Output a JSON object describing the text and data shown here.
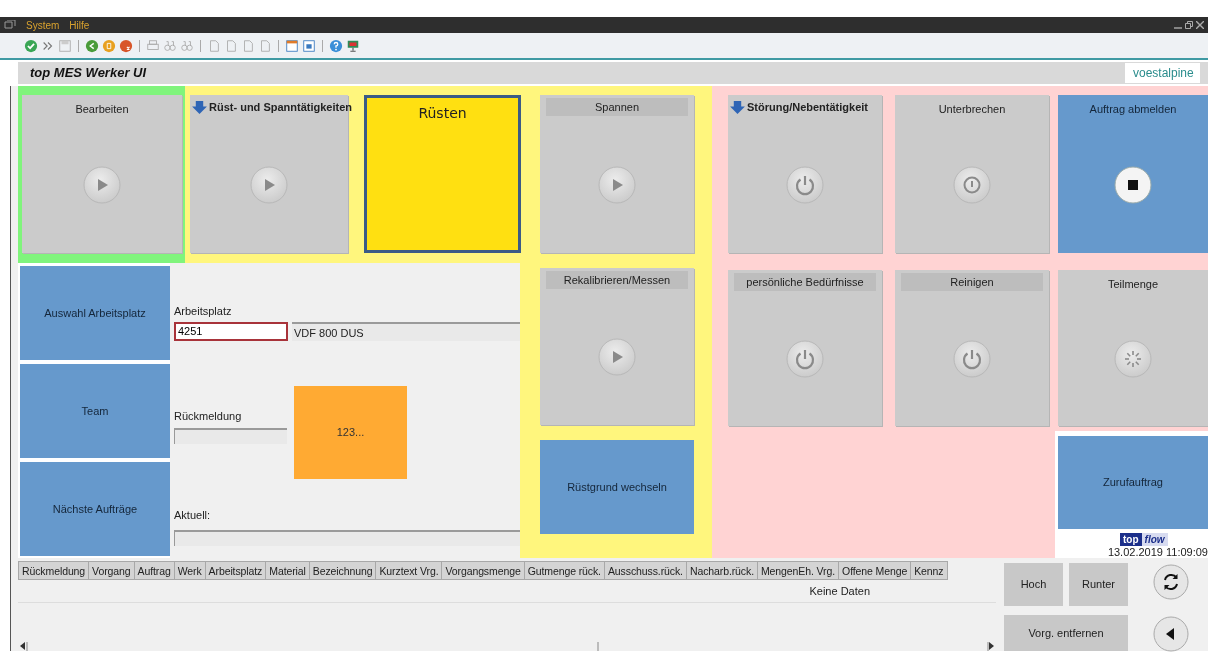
{
  "menu": [
    {
      "label": "System"
    },
    {
      "label": "Hilfe"
    }
  ],
  "app_title": "top MES Werker UI",
  "brand": "voestalpine",
  "zones": [
    {
      "color": "#80f47c",
      "tiles": [
        {
          "label": "Bearbeiten",
          "kind": "play",
          "banded": false,
          "group": false
        }
      ]
    },
    {
      "color": "#fff67d",
      "tiles": [
        {
          "label": "Rüst- und Spanntätigkeiten",
          "kind": "play",
          "banded": true,
          "group": true
        },
        {
          "label": "Rüsten",
          "kind": "current",
          "banded": false,
          "group": false
        }
      ]
    },
    {
      "color": "#fff67d",
      "tiles": [
        {
          "label": "Spannen",
          "kind": "play",
          "banded": true,
          "group": false
        },
        {
          "label": "Rekalibrieren/Messen",
          "kind": "play",
          "banded": true,
          "group": false
        },
        {
          "label": "Rüstgrund wechseln",
          "kind": "action"
        }
      ]
    },
    {
      "color": "#ffd3d3",
      "tiles": [
        {
          "label": "Störung/Nebentätigkeit",
          "kind": "power",
          "banded": true,
          "group": true
        },
        {
          "label": "Unterbrechen",
          "kind": "pause",
          "banded": false,
          "group": false
        },
        {
          "label": "Auftrag abmelden",
          "kind": "stop"
        },
        {
          "label": "persönliche Bedürfnisse",
          "kind": "power",
          "banded": true,
          "group": false
        },
        {
          "label": "Reinigen",
          "kind": "power",
          "banded": true,
          "group": false
        },
        {
          "label": "Teilmenge",
          "kind": "spinner",
          "banded": false,
          "group": false
        }
      ]
    }
  ],
  "call_panel": {
    "tiles": [
      {
        "label": "Zurufauftrag",
        "kind": "action"
      }
    ],
    "logo": {
      "first": "top",
      "second": "flow"
    },
    "timestamp": "13.02.2019 11:09:09"
  },
  "nav": [
    {
      "label": "Auswahl Arbeitsplatz"
    },
    {
      "label": "Team"
    },
    {
      "label": "Nächste Aufträge"
    }
  ],
  "workplace": {
    "label": "Arbeitsplatz",
    "value": "4251",
    "description": "VDF 800 DUS",
    "focused": true
  },
  "feedback": {
    "label": "Rückmeldung"
  },
  "counter": "123...",
  "current": {
    "label": "Aktuell:"
  },
  "table": {
    "columns": [
      "Rückmeldung",
      "Vorgang",
      "Auftrag",
      "Werk",
      "Arbeitsplatz",
      "Material",
      "Bezeichnung",
      "Kurztext Vrg.",
      "Vorgangsmenge",
      "Gutmenge rück.",
      "Ausschuss.rück.",
      "Nacharb.rück.",
      "MengenEh. Vrg.",
      "Offene Menge",
      "Kennz"
    ],
    "empty_text": "Keine Daten"
  },
  "buttons": [
    {
      "label": "Hoch"
    },
    {
      "label": "Runter"
    },
    {
      "label": "Vorg. entfernen"
    }
  ]
}
